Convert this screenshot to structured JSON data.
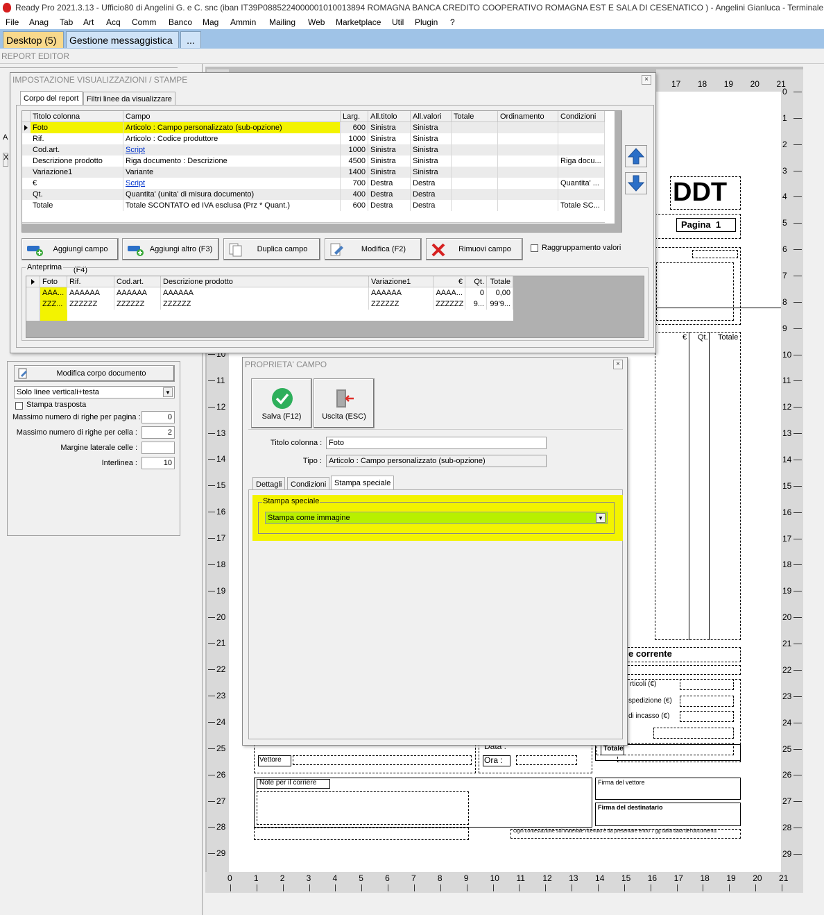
{
  "window": {
    "title": "Ready Pro 2021.3.13 - Ufficio80 di Angelini G. e C. snc (iban IT39P0885224000001010013894  ROMAGNA BANCA CREDITO COOPERATIVO ROMAGNA EST E SALA DI CESENATICO ) - Angelini Gianluca - Terminale 146 - JET"
  },
  "menu": [
    "File",
    "Anag",
    "Tab",
    "Art",
    "Acq",
    "Comm",
    "Banco",
    "Mag",
    "Ammin",
    "Mailing",
    "Web",
    "Marketplace",
    "Util",
    "Plugin",
    "?"
  ],
  "tabs": [
    {
      "label": "Desktop (5)"
    },
    {
      "label": "Gestione messaggistica"
    },
    {
      "label": "..."
    }
  ],
  "report_editor": {
    "title": "REPORT EDITOR",
    "modify_body_label": "Modifica corpo documento",
    "lines_select": "Solo linee verticali+testa",
    "transpose_label": "Stampa trasposta",
    "fields": [
      {
        "label": "Massimo numero di righe per pagina :",
        "value": "0"
      },
      {
        "label": "Massimo numero di righe per cella :",
        "value": "2"
      },
      {
        "label": "Margine laterale celle :",
        "value": ""
      },
      {
        "label": "Interlinea :",
        "value": "10"
      }
    ],
    "ruler_top": [
      "17",
      "18",
      "19",
      "20",
      "21"
    ],
    "ruler_bottom": [
      "0",
      "1",
      "2",
      "3",
      "4",
      "5",
      "6",
      "7",
      "8",
      "9",
      "10",
      "11",
      "12",
      "13",
      "14",
      "15",
      "16",
      "17",
      "18",
      "19",
      "20",
      "21"
    ],
    "ruler_right": [
      "0",
      "1",
      "2",
      "3",
      "4",
      "5",
      "6",
      "7",
      "8",
      "9",
      "10",
      "11",
      "12",
      "13",
      "14",
      "15",
      "16",
      "17",
      "18",
      "19",
      "20",
      "21",
      "22",
      "23",
      "24",
      "25",
      "26",
      "27",
      "28",
      "29"
    ],
    "ruler_left": [
      "10",
      "11",
      "12",
      "13",
      "14",
      "15",
      "16",
      "17",
      "18",
      "19",
      "20",
      "21",
      "22",
      "23",
      "24",
      "25",
      "26",
      "27",
      "28",
      "29"
    ],
    "doc": {
      "ddt": "DDT",
      "pagina": "Pagina",
      "pagina_num": "1",
      "col_euro": "€",
      "col_qt": "Qt.",
      "col_totale": "Totale",
      "corrente": "e corrente",
      "articoli": "rticoli (€)",
      "spedizione": "spedizione (€)",
      "incasso": "di incasso (€)",
      "totale": "Totale",
      "data": "Data :",
      "ora": "Ora :",
      "vettore": "Vettore",
      "note_corriere": "Note per il corriere",
      "firma_vettore": "Firma del vettore",
      "firma_destinatario": "Firma del destinatario",
      "contestazione": "Ogni contestazione sul materiale ricevuto è da presentare entro 7 gg dalla data del documento."
    }
  },
  "settings_dialog": {
    "title": "IMPOSTAZIONE VISUALIZZAZIONI / STAMPE",
    "close": "×",
    "tabs": [
      "Corpo del report",
      "Filtri linee da visualizzare"
    ],
    "columns": [
      "Titolo colonna",
      "Campo",
      "Larg.",
      "All.titolo",
      "All.valori",
      "Totale",
      "Ordinamento",
      "Condizioni"
    ],
    "rows": [
      {
        "titolo": "Foto",
        "campo": "Articolo : Campo personalizzato (sub-opzione)",
        "larg": "600",
        "all_titolo": "Sinistra",
        "all_valori": "Sinistra",
        "totale": "",
        "ordinamento": "",
        "condizioni": "",
        "link": false
      },
      {
        "titolo": "Rif.",
        "campo": "Articolo : Codice produttore",
        "larg": "1000",
        "all_titolo": "Sinistra",
        "all_valori": "Sinistra",
        "totale": "",
        "ordinamento": "",
        "condizioni": "",
        "link": false
      },
      {
        "titolo": "Cod.art.",
        "campo": "Script",
        "larg": "1000",
        "all_titolo": "Sinistra",
        "all_valori": "Sinistra",
        "totale": "",
        "ordinamento": "",
        "condizioni": "",
        "link": true
      },
      {
        "titolo": "Descrizione prodotto",
        "campo": "Riga documento : Descrizione",
        "larg": "4500",
        "all_titolo": "Sinistra",
        "all_valori": "Sinistra",
        "totale": "",
        "ordinamento": "",
        "condizioni": "Riga docu...",
        "link": false
      },
      {
        "titolo": "Variazione1",
        "campo": "Variante",
        "larg": "1400",
        "all_titolo": "Sinistra",
        "all_valori": "Sinistra",
        "totale": "",
        "ordinamento": "",
        "condizioni": "",
        "link": false
      },
      {
        "titolo": "€",
        "campo": "Script",
        "larg": "700",
        "all_titolo": "Destra",
        "all_valori": "Destra",
        "totale": "",
        "ordinamento": "",
        "condizioni": "Quantita' ...",
        "link": true
      },
      {
        "titolo": "Qt.",
        "campo": "Quantita' (unita' di misura documento)",
        "larg": "400",
        "all_titolo": "Destra",
        "all_valori": "Destra",
        "totale": "",
        "ordinamento": "",
        "condizioni": "",
        "link": false
      },
      {
        "titolo": "Totale",
        "campo": "Totale SCONTATO ed IVA esclusa (Prz * Quant.)",
        "larg": "600",
        "all_titolo": "Destra",
        "all_valori": "Destra",
        "totale": "",
        "ordinamento": "",
        "condizioni": "Totale SC...",
        "link": false
      }
    ],
    "buttons": {
      "add_field": "Aggiungi campo (F4)",
      "add_other": "Aggiungi altro (F3)",
      "duplicate": "Duplica campo",
      "modify": "Modifica (F2)",
      "remove": "Rimuovi campo",
      "grouping": "Raggruppamento valori"
    },
    "preview": {
      "label": "Anteprima",
      "columns": [
        "Foto",
        "Rif.",
        "Cod.art.",
        "Descrizione prodotto",
        "Variazione1",
        "€",
        "Qt.",
        "Totale"
      ],
      "rows": [
        [
          "AAA...",
          "AAAAAA",
          "AAAAAA",
          "AAAAAA",
          "AAAAAA",
          "AAAA...",
          "0",
          "0,00"
        ],
        [
          "ZZZ...",
          "ZZZZZZ",
          "ZZZZZZ",
          "ZZZZZZ",
          "ZZZZZZ",
          "ZZZZZZ",
          "9...",
          "99'9..."
        ]
      ]
    }
  },
  "field_dialog": {
    "title": "PROPRIETA' CAMPO",
    "close": "×",
    "save_label": "Salva (F12)",
    "exit_label": "Uscita (ESC)",
    "titolo_label": "Titolo colonna :",
    "titolo_value": "Foto",
    "tipo_label": "Tipo :",
    "tipo_value": "Articolo : Campo personalizzato (sub-opzione)",
    "tabs": [
      "Dettagli",
      "Condizioni",
      "Stampa speciale"
    ],
    "group_label": "Stampa speciale",
    "special_print_value": "Stampa come immagine"
  },
  "colors": {
    "highlight": "#f3f300",
    "selected_green": "#b8f000",
    "tab_bar": "#9fc3e7",
    "desktop_tab": "#f8d98c"
  }
}
